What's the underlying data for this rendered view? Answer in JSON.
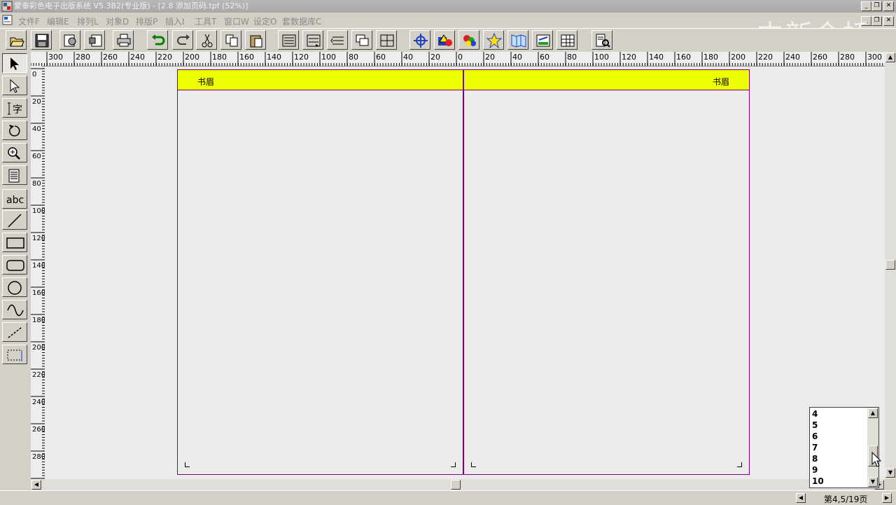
{
  "window": {
    "title": "蒙泰彩色电子出版系统 V5.3B2(专业版) - [2.8 添加页码.tpf (52%)]",
    "min_glyph": "_",
    "max_glyph": "❐",
    "close_glyph": "✕"
  },
  "menu": [
    "文件F",
    "编辑E",
    "排列L",
    "对象D",
    "排版P",
    "插入I",
    "工具T",
    "窗口W",
    "设定O",
    "套数据库C"
  ],
  "watermark": "中新金桥",
  "ruler": {
    "h_labels": [
      "300",
      "280",
      "260",
      "240",
      "220",
      "200",
      "180",
      "160",
      "140",
      "120",
      "100",
      "80",
      "60",
      "40",
      "20",
      "0",
      "20",
      "40",
      "60",
      "80",
      "100",
      "120",
      "140",
      "160",
      "180",
      "200",
      "220",
      "240",
      "260",
      "280",
      "300"
    ],
    "v_labels": [
      "0",
      "20",
      "40",
      "60",
      "80",
      "100",
      "120",
      "140",
      "160",
      "180",
      "200",
      "220",
      "240",
      "260",
      "280",
      "300"
    ]
  },
  "pages": {
    "left_header": "书眉",
    "right_header": "书眉"
  },
  "page_list": {
    "items": [
      "4",
      "5",
      "6",
      "7",
      "8",
      "9",
      "10"
    ]
  },
  "status": {
    "page_info": "第4,5/19页"
  },
  "colors": {
    "header_fill": "#eeff00",
    "page_border": "#800080",
    "canvas_bg": "#ebebeb",
    "chrome": "#d4d0c8"
  }
}
